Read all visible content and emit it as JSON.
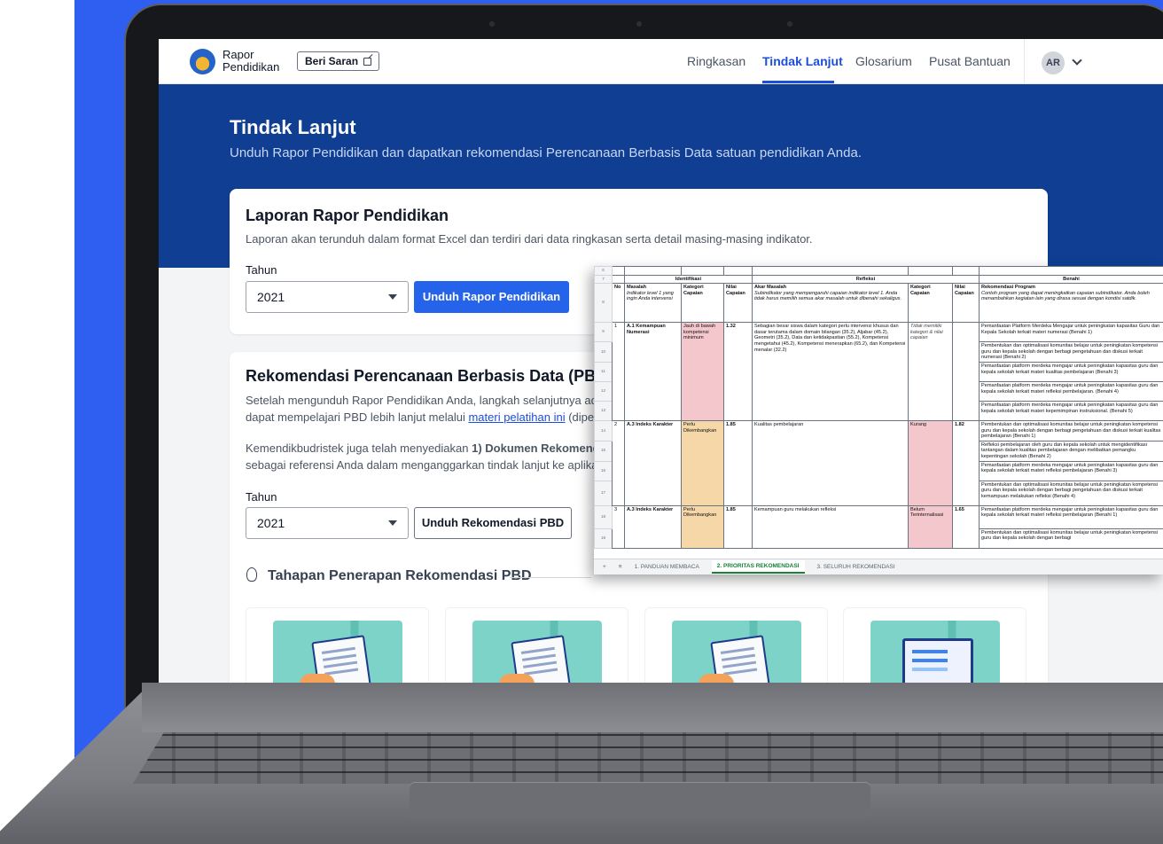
{
  "navbar": {
    "brand_line1": "Rapor",
    "brand_line2": "Pendidikan",
    "feedback_button": "Beri Saran",
    "links": [
      "Ringkasan",
      "Tindak Lanjut",
      "Glosarium",
      "Pusat Bantuan"
    ],
    "active_link": "Tindak Lanjut",
    "user_initials": "AR"
  },
  "hero": {
    "title": "Tindak Lanjut",
    "subtitle": "Unduh Rapor Pendidikan dan dapatkan rekomendasi Perencanaan Berbasis Data satuan pendidikan Anda."
  },
  "report_card": {
    "title": "Laporan Rapor Pendidikan",
    "description": "Laporan akan terunduh dalam format Excel dan terdiri dari data ringkasan serta detail masing-masing indikator.",
    "year_label": "Tahun",
    "year_value": "2021",
    "download_button": "Unduh Rapor Pendidikan"
  },
  "pbd_card": {
    "title": "Rekomendasi Perencanaan Berbasis Data (PBD)",
    "desc_line1": "Setelah mengunduh Rapor Pendidikan Anda, langkah selanjutnya ada",
    "desc_line2_start": "dapat mempelajari PBD lebih lanjut melalui ",
    "desc_link": "materi pelatihan ini",
    "desc_line2_end": " (diperl",
    "desc2_line1_start": "Kemendikbudristek juga telah menyediakan ",
    "desc2_line1_bold": "1) Dokumen Rekomenda",
    "desc2_line2": "sebagai referensi Anda dalam menganggarkan tindak lanjut ke aplikas",
    "year_label": "Tahun",
    "year_value": "2021",
    "download_button": "Unduh Rekomendasi PBD",
    "steps_title": "Tahapan Penerapan Rekomendasi PBD"
  },
  "spreadsheet": {
    "row_numbers": [
      "6",
      "7",
      "8",
      "9",
      "10",
      "11",
      "12",
      "13",
      "14",
      "15",
      "16",
      "17",
      "18",
      "19"
    ],
    "group_headers": {
      "identifikasi": "Identifikasi",
      "refleksi": "Refleksi",
      "benahi": "Benahi"
    },
    "headers": {
      "no": "No",
      "masalah": "Masalah",
      "masalah_note": "Indikator level 1 yang ingin Anda intervensi",
      "kategori": "Kategori Capaian",
      "nilai": "Nilai Capaian",
      "akar": "Akar Masalah",
      "akar_note": "Subindikator yang mempengaruhi capaian indikator level 1. Anda tidak harus memilih semua akar masalah untuk dibenahi sekaligus.",
      "kategori2": "Kategori Capaian",
      "nilai2": "Nilai Capaian",
      "rekom": "Rekomendasi Program",
      "rekom_note": "Contoh program yang dapat meningkatkan capaian subindikator. Anda boleh menambahkan kegiatan lain yang dirasa sesuai dengan kondisi satdik."
    },
    "rows": [
      {
        "no": "1",
        "masalah": "A.1 Kemampuan Numerasi",
        "kategori": "Jauh di bawah kompetensi minimum",
        "nilai": "1.32",
        "akar": "Sebagian besar siswa dalam kategori perlu intervensi khusus dan dasar terutama dalam domain bilangan (35.2), Aljabar (45.2), Geometri (35.2), Data dan ketidakpastian (55.2), Kompetensi mengetahui (45.2), Kompetensi menerapkan (65.2), dan Kompetensi menalar (32.2)",
        "kategori2": "Tidak memiliki kategori & nilai capaian",
        "nilai2": "",
        "rekom": [
          "Pemanfaatan Platform Merdeka Mengajar untuk peningkatan kapasitas Guru dan Kepala Sekolah terkait materi numerasi (Benahi 1)",
          "Pembentukan dan optimalisasi komunitas belajar untuk peningkatan kompetensi guru dan kepala sekolah dengan berbagi pengetahuan dan diskusi terkait numerasi (Benahi 2)",
          "Pemanfaatan platform merdeka mengajar untuk peningkatan kapasitas guru dan kepala sekolah terkait materi kualitas pembelajaran (Benahi 3)",
          "Pemanfaatan platform merdeka mengajar untuk peningkatan kapasitas guru dan kepala sekolah terkait materi refleksi pembelajaran. (Benahi 4)",
          "Pemanfaatan platform merdeka mengajar untuk peningkatan kapasitas guru dan kepala sekolah terkait materi kepemimpinan instruksional. (Benahi 5)"
        ]
      },
      {
        "no": "2",
        "masalah": "A.3 Indeks Karakter",
        "kategori": "Perlu Dikembangkan",
        "nilai": "1.85",
        "akar": "Kualitas pembelajaran",
        "kategori2": "Kurang",
        "nilai2": "1.82",
        "rekom": [
          "Pembentukan dan optimalisasi komunitas belajar untuk peningkatan kompetensi guru dan kepala sekolah dengan berbagi pengetahuan dan diskusi terkait kualitas pembelajaran (Benahi 1)",
          "Refleksi pembelajaran oleh guru dan kepala sekolah untuk mengidentifikasi tantangan dalam kualitas pembelajaran dengan melibatkan pemangku kepentingan sekolah (Benahi 2)",
          "Pemanfaatan platform merdeka mengajar untuk peningkatan kapasitas guru dan kepala sekolah terkait materi refleksi pembelajaran (Benahi 3)",
          "Pembentukan dan optimalisasi komunitas belajar untuk peningkatan kompetensi guru dan kepala sekolah dengan berbagi pengetahuan dan diskusi terkait kemampuan melakukan refleksi (Benahi 4)"
        ]
      },
      {
        "no": "3",
        "masalah": "A.3 Indeks Karakter",
        "kategori": "Perlu Dikembangkan",
        "nilai": "1.85",
        "akar": "Kemampuan guru melakukan refleksi",
        "kategori2": "Belum Terinternalisasi",
        "nilai2": "1.65",
        "rekom": [
          "Pemanfaatan platform merdeka mengajar untuk peningkatan kapasitas guru dan kepala sekolah terkait materi refleksi pembelajaran (Benahi 1)",
          "Pembentukan dan optimalisasi komunitas belajar untuk peningkatan kompetensi guru dan kepala sekolah dengan berbagi"
        ]
      }
    ],
    "sheet_tabs": [
      "1. PANDUAN MEMBACA",
      "2. PRIORITAS REKOMENDASI",
      "3. SELURUH REKOMENDASI"
    ],
    "active_tab": "2. PRIORITAS REKOMENDASI"
  },
  "colors": {
    "backdrop": "#2f5ff0",
    "hero": "#0f3e92",
    "primary": "#2563eb",
    "cell_red": "#f4c7cc",
    "cell_orange": "#f6d7a8"
  }
}
